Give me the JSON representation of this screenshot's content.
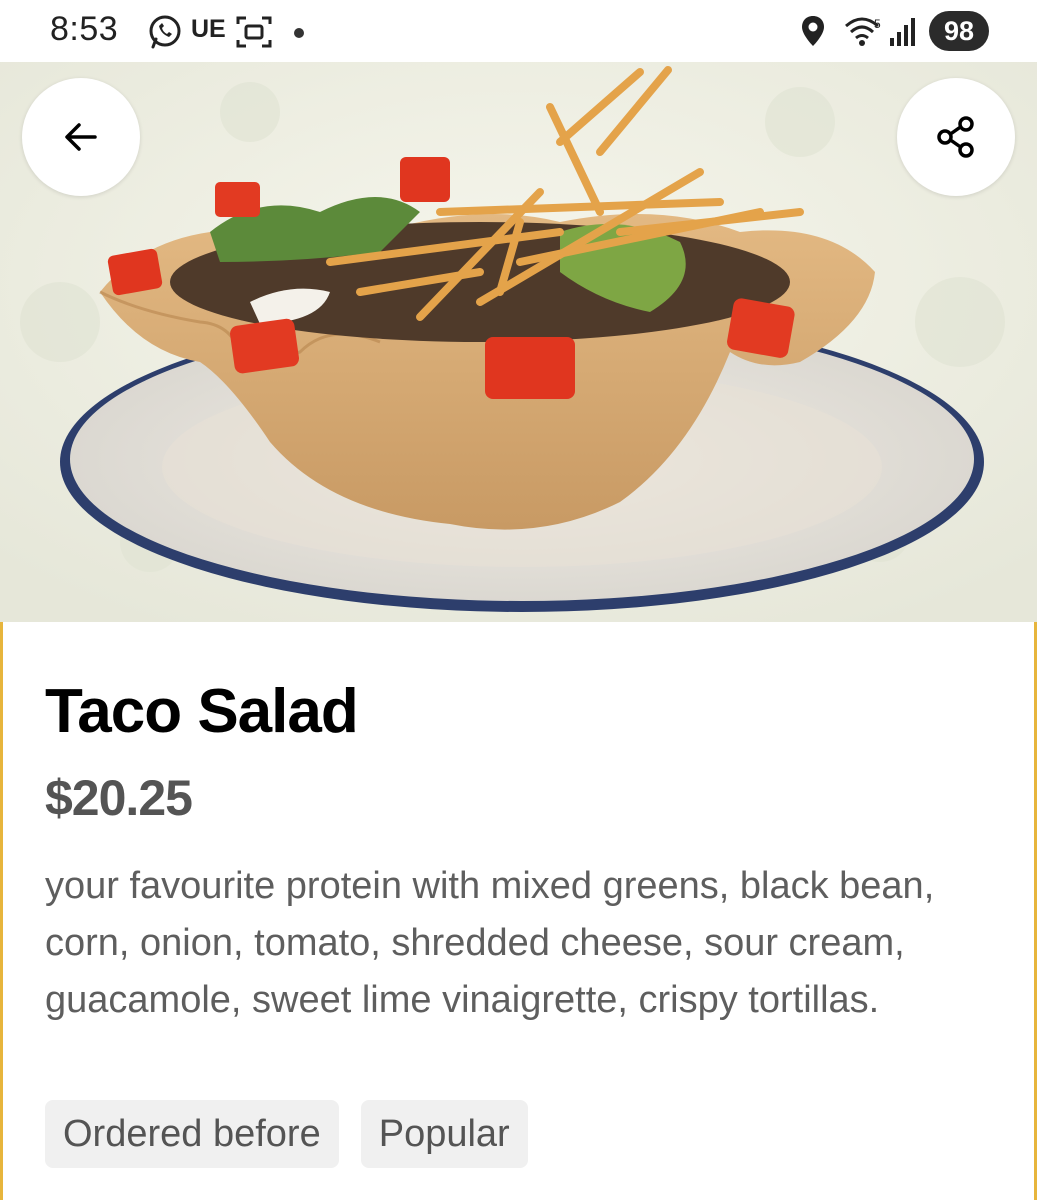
{
  "status_bar": {
    "time": "8:53",
    "carrier_badge": "UE",
    "battery": "98",
    "icons": [
      "whatsapp-icon",
      "screenshot-icon",
      "location-icon",
      "wifi-icon",
      "signal-icon"
    ]
  },
  "hero": {
    "image": "taco-salad-photo",
    "back_icon": "arrow-left-icon",
    "share_icon": "share-icon"
  },
  "item": {
    "title": "Taco Salad",
    "price": "$20.25",
    "description": "your favourite protein with mixed greens, black bean, corn, onion, tomato, shredded cheese, sour cream, guacamole, sweet lime vinaigrette, crispy tortillas.",
    "tags": [
      "Ordered before",
      "Popular"
    ]
  },
  "colors": {
    "accent_border": "#e7b53c",
    "price_text": "#545454",
    "tag_bg": "#f0f0f0"
  }
}
